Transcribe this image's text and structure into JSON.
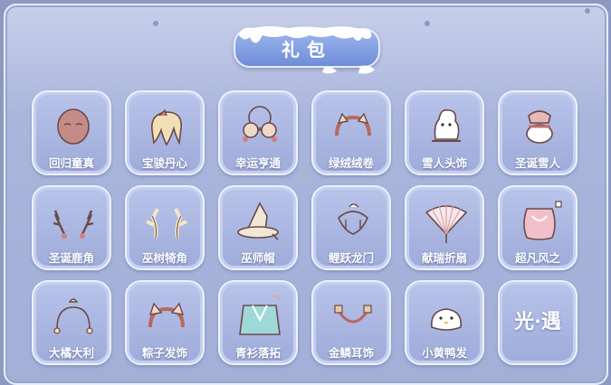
{
  "title": "礼包",
  "items": [
    {
      "label": "回归童真",
      "icon": "mask-icon"
    },
    {
      "label": "宝骏丹心",
      "icon": "hair-icon"
    },
    {
      "label": "幸运亨通",
      "icon": "glasses-icon"
    },
    {
      "label": "绿绒绒卷",
      "icon": "headband-icon"
    },
    {
      "label": "雪人头饰",
      "icon": "snowman-icon"
    },
    {
      "label": "圣诞雪人",
      "icon": "snowman-hat-icon"
    },
    {
      "label": "圣诞鹿角",
      "icon": "antlers-icon"
    },
    {
      "label": "巫树犄角",
      "icon": "branch-horns-icon"
    },
    {
      "label": "巫师帽",
      "icon": "witch-hat-icon"
    },
    {
      "label": "鲤跃龙门",
      "icon": "fish-ornament-icon"
    },
    {
      "label": "献瑞折扇",
      "icon": "fan-icon"
    },
    {
      "label": "超凡风之",
      "icon": "cape-icon"
    },
    {
      "label": "大橘大利",
      "icon": "cat-ears-icon"
    },
    {
      "label": "粽子发饰",
      "icon": "ears-headband-icon"
    },
    {
      "label": "青衫落拓",
      "icon": "robe-icon"
    },
    {
      "label": "金鳞耳饰",
      "icon": "earring-icon"
    },
    {
      "label": "小黄鸭发",
      "icon": "duck-icon"
    },
    {
      "label": "",
      "icon": "sky-logo-icon",
      "logo_text": "光·遇"
    }
  ],
  "colors": {
    "panel": "#a9b4db",
    "tile": "#aeb9e2",
    "title_button": "#7f9ce0",
    "label": "#ffffff"
  }
}
